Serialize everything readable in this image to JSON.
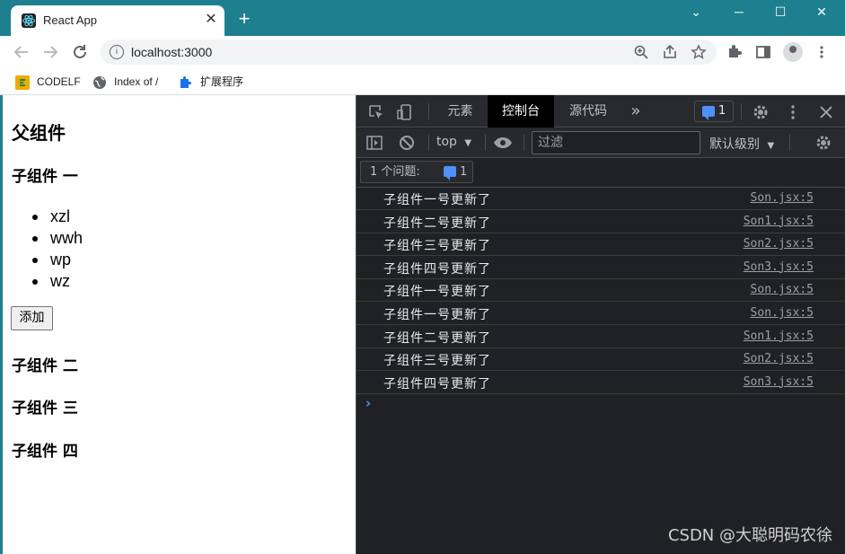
{
  "browser": {
    "tab_title": "React App",
    "tab_close": "✕",
    "new_tab": "+",
    "window_buttons": {
      "dropdown": "⌄",
      "minimize": "─",
      "maximize": "☐",
      "close": "✕"
    },
    "url": "localhost:3000",
    "icons": {
      "back": "back-arrow-icon",
      "forward": "forward-arrow-icon",
      "reload": "reload-icon",
      "info": "info-icon",
      "zoom": "zoom-icon",
      "share": "share-icon",
      "star": "bookmark-star-icon",
      "extensions": "puzzle-icon",
      "sidepanel": "side-panel-icon",
      "profile": "profile-icon",
      "menu": "kebab-menu-icon"
    },
    "bookmarks": [
      {
        "label": "CODELF",
        "icon_color": "#f2a900"
      },
      {
        "label": "Index of /",
        "icon_color": "#5f6368"
      },
      {
        "label": "扩展程序",
        "icon_color": "#1a73e8"
      }
    ]
  },
  "page": {
    "heading": "父组件",
    "child_one": "子组件 一",
    "list": [
      "xzl",
      "wwh",
      "wp",
      "wz"
    ],
    "add_button": "添加",
    "child_two": "子组件 二",
    "child_three": "子组件 三",
    "child_four": "子组件 四"
  },
  "devtools": {
    "tabs": [
      "元素",
      "控制台",
      "源代码"
    ],
    "active_tab": "控制台",
    "more": "»",
    "issue_count": "1",
    "context": "top",
    "filter_placeholder": "过滤",
    "level": "默认级别",
    "issues_label": "1 个问题:",
    "issues_count": "1",
    "logs": [
      {
        "message": "子组件一号更新了",
        "source": "Son.jsx:5"
      },
      {
        "message": "子组件二号更新了",
        "source": "Son1.jsx:5"
      },
      {
        "message": "子组件三号更新了",
        "source": "Son2.jsx:5"
      },
      {
        "message": "子组件四号更新了",
        "source": "Son3.jsx:5"
      },
      {
        "message": "子组件一号更新了",
        "source": "Son.jsx:5"
      },
      {
        "message": "子组件一号更新了",
        "source": "Son.jsx:5"
      },
      {
        "message": "子组件二号更新了",
        "source": "Son1.jsx:5"
      },
      {
        "message": "子组件三号更新了",
        "source": "Son2.jsx:5"
      },
      {
        "message": "子组件四号更新了",
        "source": "Son3.jsx:5"
      }
    ],
    "prompt": "›"
  },
  "watermark": "CSDN @大聪明码农徐",
  "colors": {
    "titlebar": "#1e7f8e",
    "devtools_bg": "#202124",
    "accent_blue": "#4d90fe"
  }
}
